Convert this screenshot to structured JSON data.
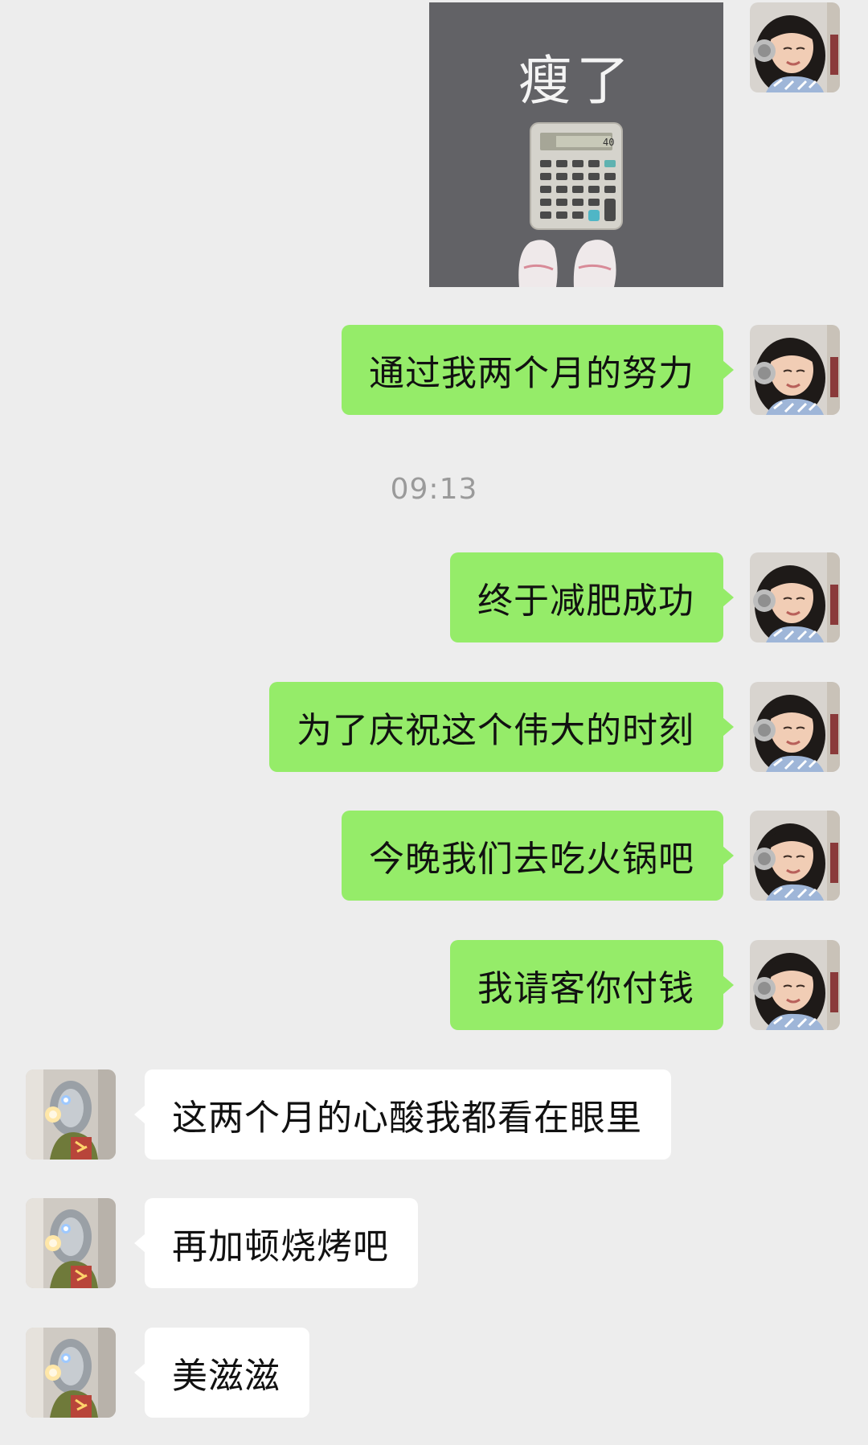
{
  "sticker": {
    "caption": "瘦了",
    "icon": "calculator-and-shoes-icon"
  },
  "timestamp": "09:13",
  "messages": [
    {
      "side": "right",
      "text": "通过我两个月的努力"
    },
    {
      "side": "right",
      "text": "终于减肥成功"
    },
    {
      "side": "right",
      "text": "为了庆祝这个伟大的时刻"
    },
    {
      "side": "right",
      "text": "今晚我们去吃火锅吧"
    },
    {
      "side": "right",
      "text": "我请客你付钱"
    },
    {
      "side": "left",
      "text": "这两个月的心酸我都看在眼里"
    },
    {
      "side": "left",
      "text": "再加顿烧烤吧"
    },
    {
      "side": "left",
      "text": "美滋滋"
    }
  ],
  "colors": {
    "background": "#ededed",
    "outgoing_bubble": "#95ec69",
    "incoming_bubble": "#ffffff",
    "timestamp_text": "#9a9a9a"
  }
}
